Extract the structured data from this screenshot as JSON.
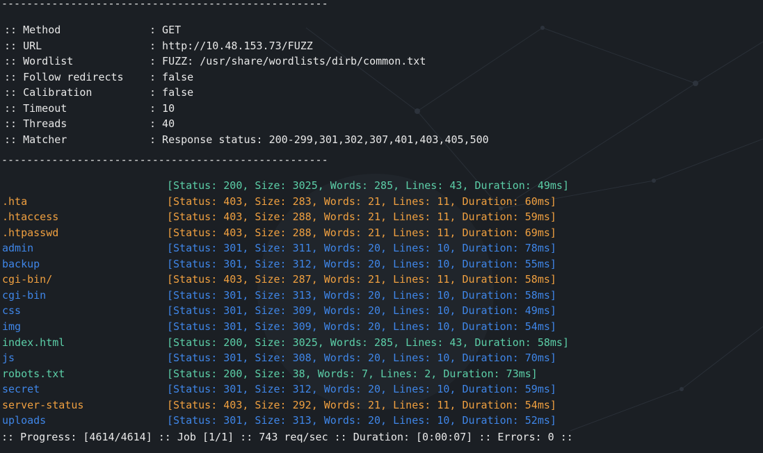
{
  "separator": "----------------------------------------------------",
  "config": [
    {
      "key": ":: Method",
      "value": ": GET"
    },
    {
      "key": ":: URL",
      "value": ": http://10.48.153.73/FUZZ"
    },
    {
      "key": ":: Wordlist",
      "value": ": FUZZ: /usr/share/wordlists/dirb/common.txt"
    },
    {
      "key": ":: Follow redirects",
      "value": ": false"
    },
    {
      "key": ":: Calibration",
      "value": ": false"
    },
    {
      "key": ":: Timeout",
      "value": ": 10"
    },
    {
      "key": ":: Threads",
      "value": ": 40"
    },
    {
      "key": ":: Matcher",
      "value": ": Response status: 200-299,301,302,307,401,403,405,500"
    }
  ],
  "results": [
    {
      "name": "",
      "status": "[Status: 200, Size: 3025, Words: 285, Lines: 43, Duration: 49ms]",
      "code": "200"
    },
    {
      "name": ".hta",
      "status": "[Status: 403, Size: 283, Words: 21, Lines: 11, Duration: 60ms]",
      "code": "403"
    },
    {
      "name": ".htaccess",
      "status": "[Status: 403, Size: 288, Words: 21, Lines: 11, Duration: 59ms]",
      "code": "403"
    },
    {
      "name": ".htpasswd",
      "status": "[Status: 403, Size: 288, Words: 21, Lines: 11, Duration: 69ms]",
      "code": "403"
    },
    {
      "name": "admin",
      "status": "[Status: 301, Size: 311, Words: 20, Lines: 10, Duration: 78ms]",
      "code": "301"
    },
    {
      "name": "backup",
      "status": "[Status: 301, Size: 312, Words: 20, Lines: 10, Duration: 55ms]",
      "code": "301"
    },
    {
      "name": "cgi-bin/",
      "status": "[Status: 403, Size: 287, Words: 21, Lines: 11, Duration: 58ms]",
      "code": "403"
    },
    {
      "name": "cgi-bin",
      "status": "[Status: 301, Size: 313, Words: 20, Lines: 10, Duration: 58ms]",
      "code": "301"
    },
    {
      "name": "css",
      "status": "[Status: 301, Size: 309, Words: 20, Lines: 10, Duration: 49ms]",
      "code": "301"
    },
    {
      "name": "img",
      "status": "[Status: 301, Size: 309, Words: 20, Lines: 10, Duration: 54ms]",
      "code": "301"
    },
    {
      "name": "index.html",
      "status": "[Status: 200, Size: 3025, Words: 285, Lines: 43, Duration: 58ms]",
      "code": "200"
    },
    {
      "name": "js",
      "status": "[Status: 301, Size: 308, Words: 20, Lines: 10, Duration: 70ms]",
      "code": "301"
    },
    {
      "name": "robots.txt",
      "status": "[Status: 200, Size: 38, Words: 7, Lines: 2, Duration: 73ms]",
      "code": "200"
    },
    {
      "name": "secret",
      "status": "[Status: 301, Size: 312, Words: 20, Lines: 10, Duration: 59ms]",
      "code": "301"
    },
    {
      "name": "server-status",
      "status": "[Status: 403, Size: 292, Words: 21, Lines: 11, Duration: 54ms]",
      "code": "403"
    },
    {
      "name": "uploads",
      "status": "[Status: 301, Size: 313, Words: 20, Lines: 10, Duration: 52ms]",
      "code": "301"
    }
  ],
  "progress": ":: Progress: [4614/4614] :: Job [1/1] :: 743 req/sec :: Duration: [0:00:07] :: Errors: 0 ::",
  "colors": {
    "background": "#1b1f24",
    "status_200": "#5ccfa8",
    "status_403": "#f0a040",
    "status_301": "#3f86e8",
    "text": "#e8e8e8"
  }
}
